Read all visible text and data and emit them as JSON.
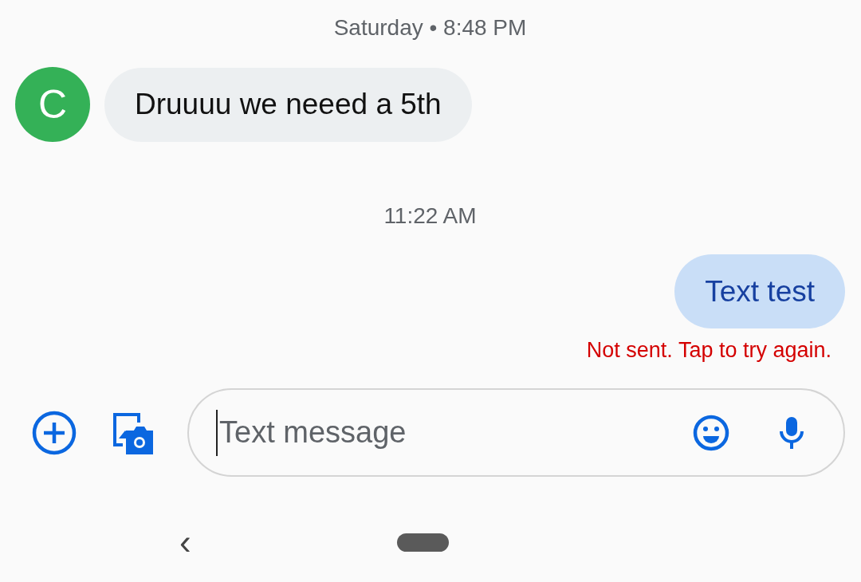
{
  "thread": [
    {
      "kind": "timestamp",
      "text": "Saturday • 8:48 PM"
    },
    {
      "kind": "incoming",
      "avatar": {
        "letter": "C",
        "color": "#34b157"
      },
      "text": "Druuuu we neeed a 5th"
    },
    {
      "kind": "timestamp",
      "text": "11:22 AM"
    },
    {
      "kind": "outgoing",
      "text": "Text test",
      "failed": true,
      "status": "Not sent. Tap to try again."
    }
  ],
  "compose": {
    "placeholder": "Text message",
    "focused": true
  },
  "nav": {
    "back": "‹"
  }
}
